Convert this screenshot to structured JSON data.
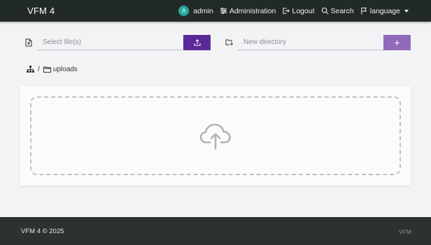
{
  "header": {
    "brand": "VFM 4",
    "user": {
      "avatar_letter": "A",
      "name": "admin"
    },
    "nav": {
      "administration": "Administration",
      "logout": "Logout",
      "search": "Search",
      "language": "language"
    }
  },
  "toolbar": {
    "select_files_placeholder": "Select file(s)",
    "new_directory_placeholder": "New directory",
    "add_label": "+"
  },
  "breadcrumb": {
    "separator": "/",
    "folder": "uploads"
  },
  "footer": {
    "left": "VFM 4 © 2025",
    "right": "VFM"
  },
  "colors": {
    "header_bg": "#222a28",
    "avatar": "#27a89c",
    "upload_button": "#5b2a9a",
    "add_button": "#8f6ab8",
    "footer_bg": "#2c3230"
  },
  "icons": [
    "user-avatar",
    "sliders-icon",
    "logout-icon",
    "search-icon",
    "flag-icon",
    "file-icon",
    "upload-icon",
    "folder-add-icon",
    "sitemap-icon",
    "folder-icon",
    "cloud-upload-icon"
  ]
}
